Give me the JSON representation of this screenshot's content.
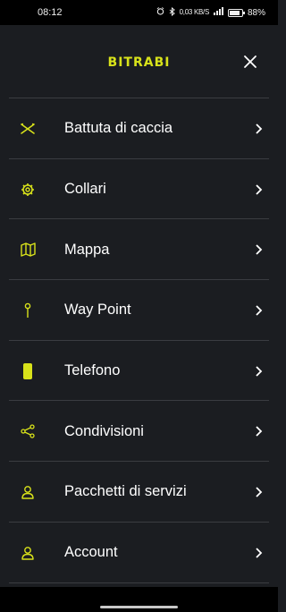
{
  "status": {
    "time": "08:12",
    "net_speed": "0,03 KB/S",
    "battery_text": "88%",
    "battery_level": 0.88
  },
  "header": {
    "logo": "BITRABI"
  },
  "menu": {
    "items": [
      {
        "label": "Battuta di caccia",
        "icon": "crossed-rifles-icon"
      },
      {
        "label": "Collari",
        "icon": "gear-icon"
      },
      {
        "label": "Mappa",
        "icon": "map-icon"
      },
      {
        "label": "Way Point",
        "icon": "pin-icon"
      },
      {
        "label": "Telefono",
        "icon": "phone-icon"
      },
      {
        "label": "Condivisioni",
        "icon": "share-icon"
      },
      {
        "label": "Pacchetti di servizi",
        "icon": "user-icon"
      },
      {
        "label": "Account",
        "icon": "user-icon"
      }
    ]
  },
  "colors": {
    "accent": "#d8e21a",
    "background": "#1b1d21",
    "divider": "#3a3c41"
  }
}
